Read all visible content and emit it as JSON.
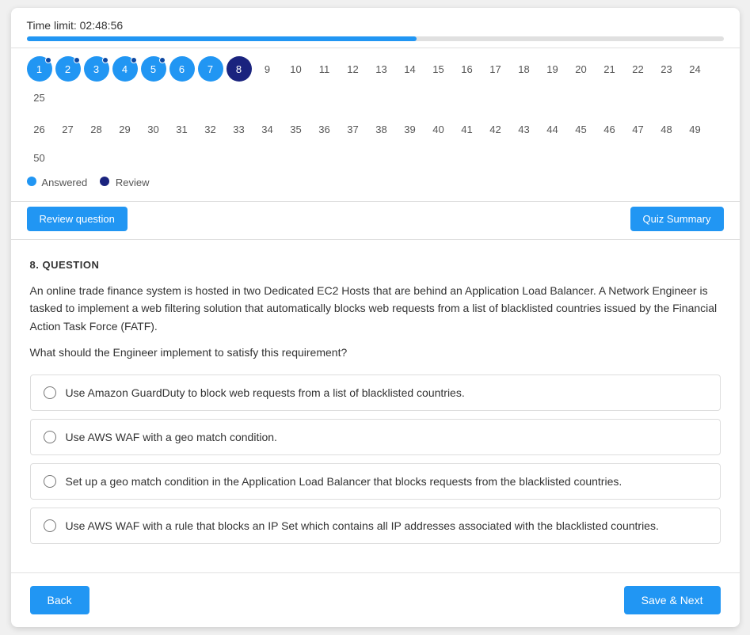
{
  "timer": {
    "label": "Time limit: 02:48:56",
    "progress_percent": 56
  },
  "legend": {
    "answered_label": "Answered",
    "review_label": "Review"
  },
  "buttons": {
    "review_question": "Review question",
    "quiz_summary": "Quiz Summary",
    "back": "Back",
    "save_next": "Save & Next"
  },
  "question_numbers": {
    "row1": [
      1,
      2,
      3,
      4,
      5,
      6,
      7,
      8,
      9,
      10,
      11,
      12,
      13,
      14,
      15,
      16,
      17,
      18,
      19,
      20,
      21,
      22,
      23,
      24,
      25
    ],
    "row2": [
      26,
      27,
      28,
      29,
      30,
      31,
      32,
      33,
      34,
      35,
      36,
      37,
      38,
      39,
      40,
      41,
      42,
      43,
      44,
      45,
      46,
      47,
      48,
      49,
      50
    ],
    "answered": [
      1,
      2,
      3,
      4,
      5,
      6,
      7
    ],
    "current": 8,
    "review": []
  },
  "question": {
    "label": "8. QUESTION",
    "text": "An online trade finance system is hosted in two Dedicated EC2 Hosts that are behind an Application Load Balancer. A Network Engineer is tasked to implement a web filtering solution that automatically blocks web requests from a list of blacklisted countries issued by the Financial Action Task Force (FATF).",
    "sub_text": "What should the Engineer implement to satisfy this requirement?",
    "options": [
      {
        "id": "opt1",
        "text": "Use Amazon GuardDuty to block web requests from a list of blacklisted countries."
      },
      {
        "id": "opt2",
        "text": "Use AWS WAF with a geo match condition."
      },
      {
        "id": "opt3",
        "text": "Set up a geo match condition in the Application Load Balancer that blocks requests from the blacklisted countries."
      },
      {
        "id": "opt4",
        "text": "Use AWS WAF with a rule that blocks an IP Set which contains all IP addresses associated with the blacklisted countries."
      }
    ]
  }
}
